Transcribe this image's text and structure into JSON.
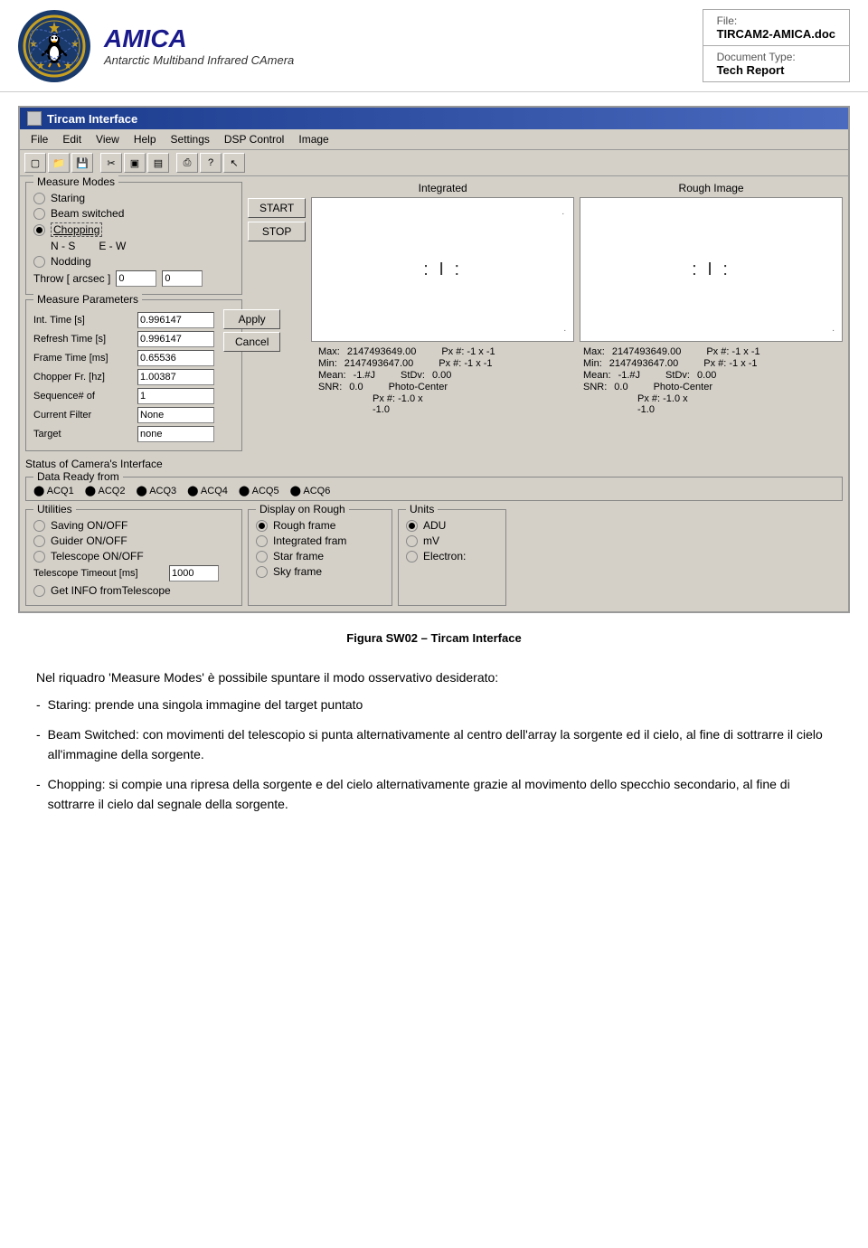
{
  "header": {
    "title": "AMICA",
    "subtitle": "Antarctic Multiband Infrared CAmera",
    "file_label": "File:",
    "file_value": "TIRCAM2-AMICA.doc",
    "doctype_label": "Document Type:",
    "doctype_value": "Tech Report"
  },
  "window": {
    "title": "Tircam Interface",
    "menubar": [
      "File",
      "Edit",
      "View",
      "Help",
      "Settings",
      "DSP Control",
      "Image"
    ]
  },
  "measure_modes": {
    "title": "Measure Modes",
    "options": [
      "Staring",
      "Beam switched",
      "Chopping",
      "Nodding"
    ],
    "selected": "Chopping",
    "nodding_labels": [
      "N - S",
      "E - W"
    ],
    "throw_label": "Throw [ arcsec ]",
    "throw_values": [
      "0",
      "0"
    ]
  },
  "buttons": {
    "start": "START",
    "stop": "STOP"
  },
  "panels": {
    "integrated_label": "Integrated",
    "rough_label": "Rough Image"
  },
  "stats": {
    "integrated": {
      "max_label": "Max:",
      "max_value": "2147493649.00",
      "px_max": "Px #:  -1 x -1",
      "min_label": "Min:",
      "min_value": "2147493647.00",
      "px_min": "Px #:  -1 x -1",
      "mean_label": "Mean:",
      "mean_value": "-1.#J",
      "stdv_label": "StDv:",
      "stdv_value": "0.00",
      "snr_label": "SNR:",
      "snr_value": "0.0",
      "photocenter_label": "Photo-Center",
      "photocenter_value": "Px #:  -1.0 x",
      "photocenter_value2": "-1.0"
    },
    "rough": {
      "max_label": "Max:",
      "max_value": "2147493649.00",
      "px_max": "Px #:  -1 x -1",
      "min_label": "Min:",
      "min_value": "2147493647.00",
      "px_min": "Px #:  -1 x -1",
      "mean_label": "Mean:",
      "mean_value": "-1.#J",
      "stdv_label": "StDv:",
      "stdv_value": "0.00",
      "snr_label": "SNR:",
      "snr_value": "0.0",
      "photocenter_label": "Photo-Center",
      "photocenter_value": "Px #:  -1.0 x",
      "photocenter_value2": "-1.0"
    }
  },
  "measure_params": {
    "title": "Measure Parameters",
    "fields": [
      {
        "label": "Int. Time [s]",
        "value": "0.996147"
      },
      {
        "label": "Refresh Time [s]",
        "value": "0.996147"
      },
      {
        "label": "Frame Time [ms]",
        "value": "0.65536"
      },
      {
        "label": "Chopper Fr. [hz]",
        "value": "1.00387"
      },
      {
        "label": "Sequence#  of",
        "value": "1"
      },
      {
        "label": "Current Filter",
        "value": "None"
      },
      {
        "label": "Target",
        "value": "none"
      }
    ],
    "apply_btn": "Apply",
    "cancel_btn": "Cancel"
  },
  "status": {
    "label": "Status of Camera's Interface"
  },
  "data_ready": {
    "title": "Data Ready from",
    "items": [
      "ACQ1",
      "ACQ2",
      "ACQ3",
      "ACQ4",
      "ACQ5",
      "ACQ6"
    ]
  },
  "utilities": {
    "title": "Utilities",
    "options": [
      "Saving ON/OFF",
      "Guider ON/OFF",
      "Telescope ON/OFF"
    ],
    "timeout_label": "Telescope Timeout [ms]",
    "timeout_value": "1000",
    "get_info": "Get INFO fromTelescope"
  },
  "display_on_rough": {
    "title": "Display on Rough",
    "options": [
      "Rough frame",
      "Integrated fram",
      "Star frame",
      "Sky frame"
    ],
    "selected": "Rough frame"
  },
  "units": {
    "title": "Units",
    "options": [
      "ADU",
      "mV",
      "Electron:"
    ],
    "selected": "ADU"
  },
  "figure_caption": "Figura SW02 – Tircam Interface",
  "text": {
    "intro": "Nel riquadro 'Measure Modes' è possibile spuntare il modo osservativo desiderato:",
    "bullets": [
      {
        "dash": "-",
        "text": "Staring: prende una singola immagine del target puntato"
      },
      {
        "dash": "-",
        "text": "Beam Switched: con movimenti del telescopio si punta alternativamente al centro dell'array la sorgente ed il cielo, al fine di sottrarre il cielo all'immagine della sorgente."
      },
      {
        "dash": "-",
        "text": "Chopping: si compie una ripresa della sorgente e del cielo alternativamente grazie al movimento dello specchio secondario, al fine di sottrarre il cielo dal segnale della sorgente."
      }
    ]
  }
}
